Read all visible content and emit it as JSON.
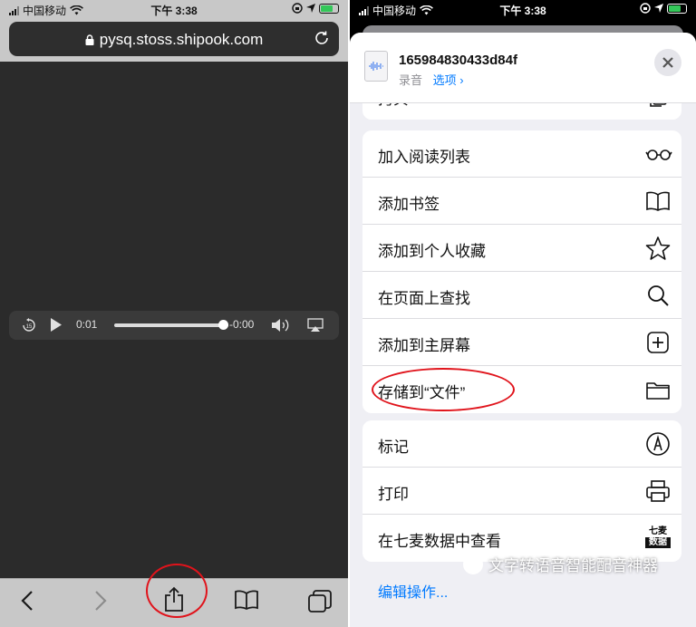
{
  "status_bar": {
    "carrier": "中国移动",
    "time": "下午 3:38"
  },
  "safari": {
    "url": "pysq.stoss.shipook.com",
    "audio": {
      "elapsed": "0:01",
      "remaining": "-0:00",
      "skip_back_seconds": "15",
      "progress": 0.95
    },
    "toolbar": {
      "icons": [
        "back-icon",
        "forward-icon",
        "share-icon",
        "bookmarks-icon",
        "tabs-icon"
      ]
    }
  },
  "share_sheet": {
    "file_name": "165984830433d84f",
    "file_type": "录音",
    "options_label": "选项",
    "partial_row_label": "拷贝",
    "group1": [
      {
        "label": "加入阅读列表",
        "icon": "glasses-icon"
      },
      {
        "label": "添加书签",
        "icon": "book-icon"
      },
      {
        "label": "添加到个人收藏",
        "icon": "star-icon"
      },
      {
        "label": "在页面上查找",
        "icon": "magnifier-icon"
      },
      {
        "label": "添加到主屏幕",
        "icon": "plus-square-icon"
      },
      {
        "label": "存储到“文件”",
        "icon": "folder-icon"
      }
    ],
    "group2": [
      {
        "label": "标记",
        "icon": "markup-pen-icon"
      },
      {
        "label": "打印",
        "icon": "printer-icon"
      },
      {
        "label": "在七麦数据中查看",
        "icon": "qimai-logo-icon"
      }
    ],
    "qimai_logo_text": [
      "七麦",
      "数据"
    ],
    "edit_actions": "编辑操作...",
    "watermark": "文字转语音智能配音神器"
  },
  "colors": {
    "highlight_circle": "#e0131b",
    "link_blue": "#007aff"
  }
}
